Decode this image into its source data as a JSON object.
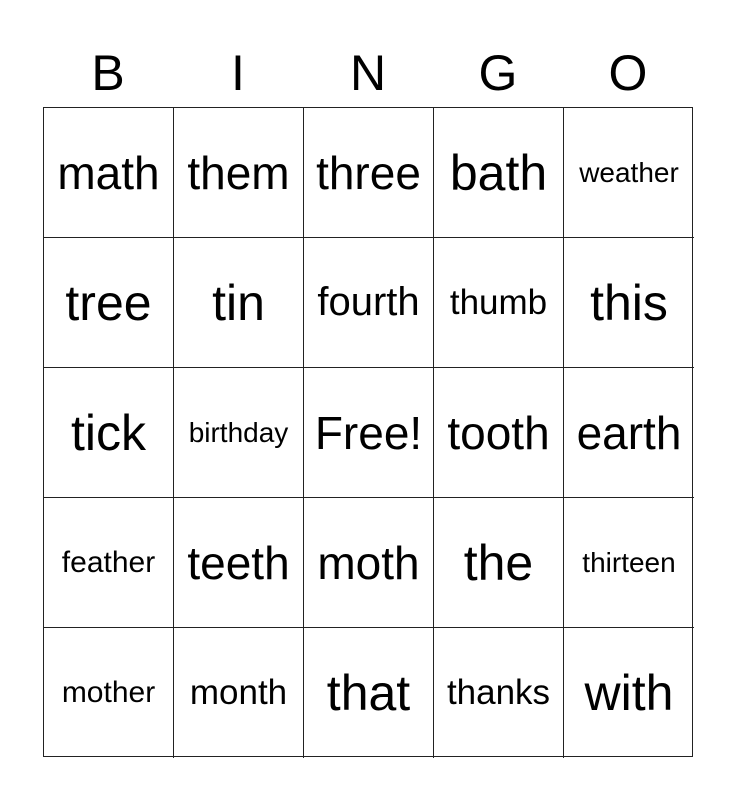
{
  "header": [
    "B",
    "I",
    "N",
    "G",
    "O"
  ],
  "cells": [
    "math",
    "them",
    "three",
    "bath",
    "weather",
    "tree",
    "tin",
    "fourth",
    "thumb",
    "this",
    "tick",
    "birthday",
    "Free!",
    "tooth",
    "earth",
    "feather",
    "teeth",
    "moth",
    "the",
    "thirteen",
    "mother",
    "month",
    "that",
    "thanks",
    "with"
  ]
}
